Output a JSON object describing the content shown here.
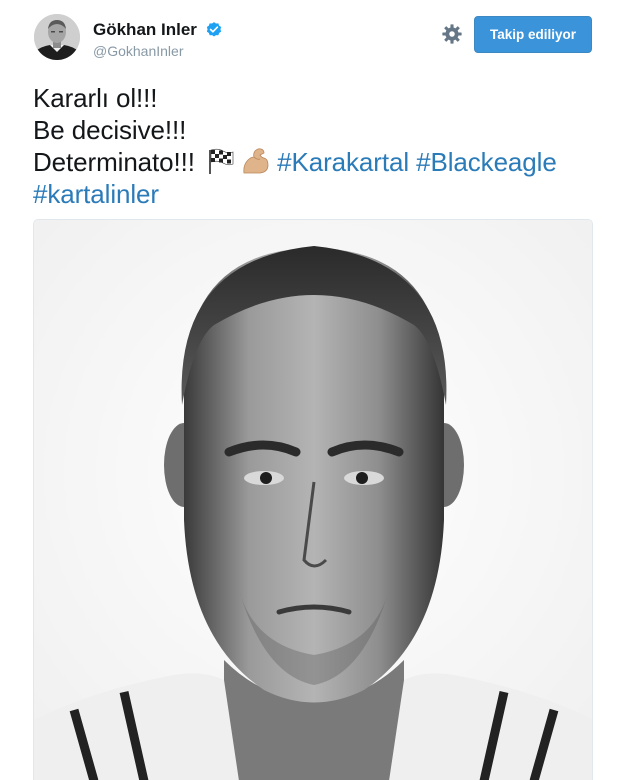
{
  "user": {
    "display_name": "Gökhan Inler",
    "handle": "@GokhanInler",
    "verified_icon": "verified-badge-icon",
    "avatar": "avatar"
  },
  "header": {
    "settings_icon": "gear-icon",
    "follow_label": "Takip ediliyor"
  },
  "tweet": {
    "line1": "Kararlı ol!!!",
    "line2": "Be decisive!!!",
    "line3_text": "Determinato!!! ",
    "emojis": [
      "chequered-flag-icon",
      "flexed-biceps-icon"
    ],
    "hashtag1": "#Karakartal",
    "hashtag2": "#Blackeagle",
    "hashtag3": "#kartalinler"
  },
  "media": {
    "kind": "photo",
    "subject": "black-and-white portrait photo"
  },
  "colors": {
    "follow_button": "#3b94d9",
    "hashtag": "#2b7bb9",
    "verified": "#1da1f2",
    "handle": "#8899a6"
  }
}
